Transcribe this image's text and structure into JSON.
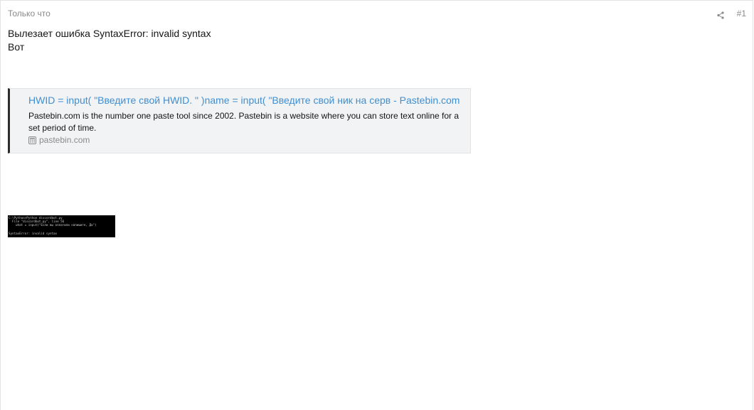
{
  "post": {
    "timestamp": "Только что",
    "number": "#1",
    "message_lines": [
      "Вылезает ошибка SyntaxError: invalid syntax",
      "Вот"
    ]
  },
  "embed": {
    "title": "HWID = input( \"Введите свой HWID. \" )name = input( \"Введите свой ник на серв - Pastebin.com",
    "description": "Pastebin.com is the number one paste tool since 2002. Pastebin is a website where you can store text online for a set period of time.",
    "source": "pastebin.com"
  },
  "attachment": {
    "console_lines": [
      "C:\\Python>Python discordbot.py",
      "  File \"discordbot.py\", line 56",
      "    what = input(\"Если вы оплатили напишите, Да\")",
      "",
      "SyntaxError: invalid syntax"
    ]
  },
  "colors": {
    "link": "#3f8fd2",
    "muted": "#8a8a8a",
    "embed_bg": "#f2f3f4",
    "embed_border": "#2c2c2c"
  }
}
